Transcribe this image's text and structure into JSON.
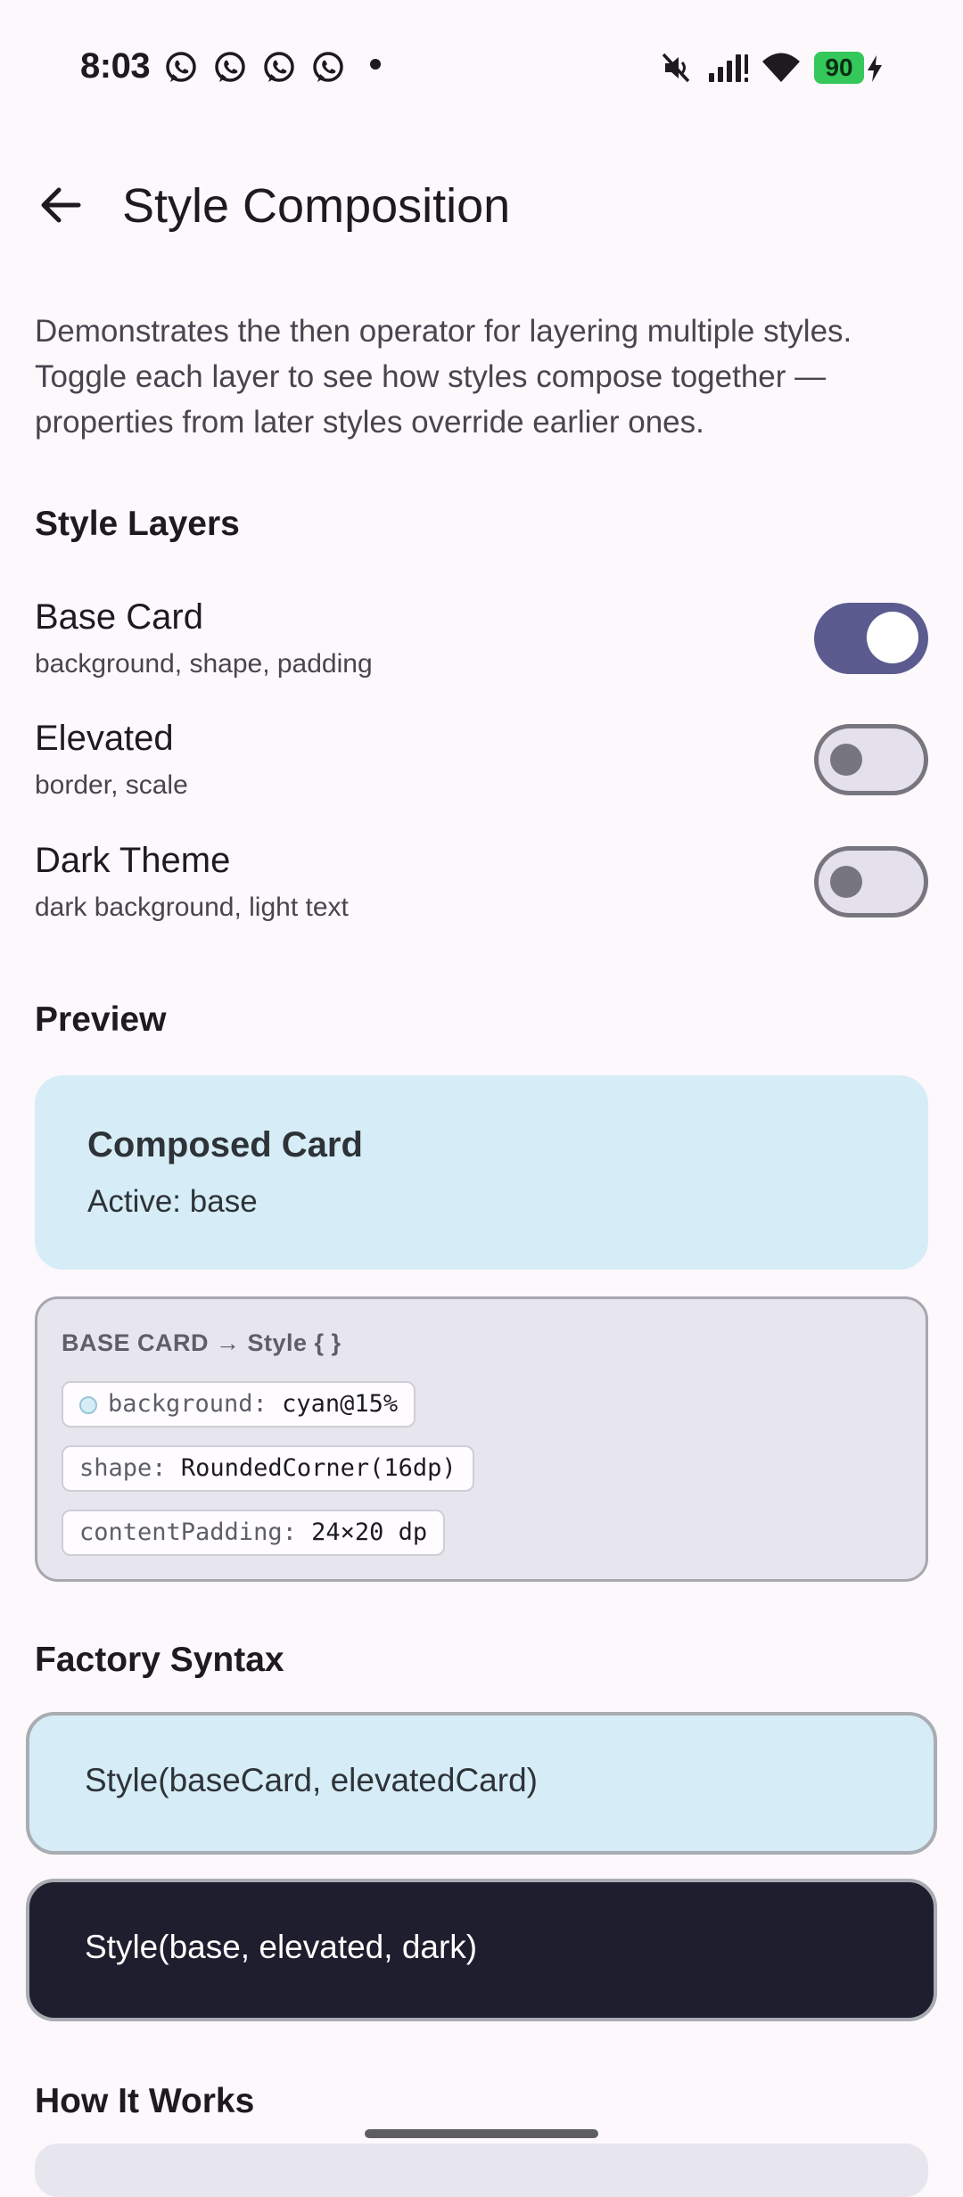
{
  "status_bar": {
    "time": "8:03",
    "notification_icons": [
      "whatsapp-icon",
      "whatsapp-icon",
      "whatsapp-icon",
      "whatsapp-icon"
    ],
    "battery_level": "90"
  },
  "app_bar": {
    "title": "Style Composition"
  },
  "description": "Demonstrates the then operator for layering multiple styles. Toggle each layer to see how styles compose together — properties from later styles override earlier ones.",
  "style_layers": {
    "title": "Style Layers",
    "items": [
      {
        "label": "Base Card",
        "subtitle": "background, shape, padding",
        "enabled": true
      },
      {
        "label": "Elevated",
        "subtitle": "border, scale",
        "enabled": false
      },
      {
        "label": "Dark Theme",
        "subtitle": "dark background, light text",
        "enabled": false
      }
    ]
  },
  "preview": {
    "title": "Preview",
    "card_title": "Composed Card",
    "active_text": "Active: base",
    "card_color": "#d6edf7"
  },
  "info_panel": {
    "header": "BASE CARD → Style { }",
    "props": [
      {
        "key": "background:",
        "value": "cyan@15%"
      },
      {
        "key": "shape:",
        "value": "RoundedCorner(16dp)"
      },
      {
        "key": "contentPadding:",
        "value": "24×20 dp"
      }
    ]
  },
  "factory_syntax": {
    "title": "Factory Syntax",
    "example_light": "Style(baseCard, elevatedCard)",
    "example_dark": "Style(base, elevated, dark)"
  },
  "how_it_works": {
    "title": "How It Works"
  },
  "colors": {
    "accent": "#5b5b8f",
    "background": "#fcf8fc",
    "cyan_card": "#d6edf7",
    "dark_card": "#1f1e2e"
  }
}
